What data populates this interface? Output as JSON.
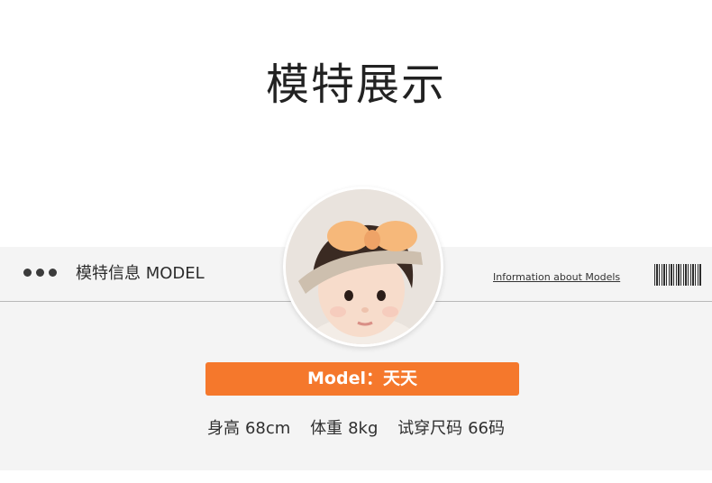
{
  "header": {
    "title": "模特展示"
  },
  "info_bar": {
    "section_label": "模特信息 MODEL",
    "info_link": "Information about Models",
    "icons": [
      "dots-icon",
      "barcode-icon"
    ]
  },
  "model": {
    "name_label": "Model：天天",
    "avatar_alt": "baby-with-orange-bow-headband"
  },
  "stats": [
    {
      "key": "身高",
      "value": "68cm"
    },
    {
      "key": "体重",
      "value": "8kg"
    },
    {
      "key": "试穿尺码",
      "value": "66码"
    }
  ],
  "colors": {
    "accent": "#f5782c",
    "band_background": "#f4f4f4",
    "text": "#2f2f2f"
  }
}
